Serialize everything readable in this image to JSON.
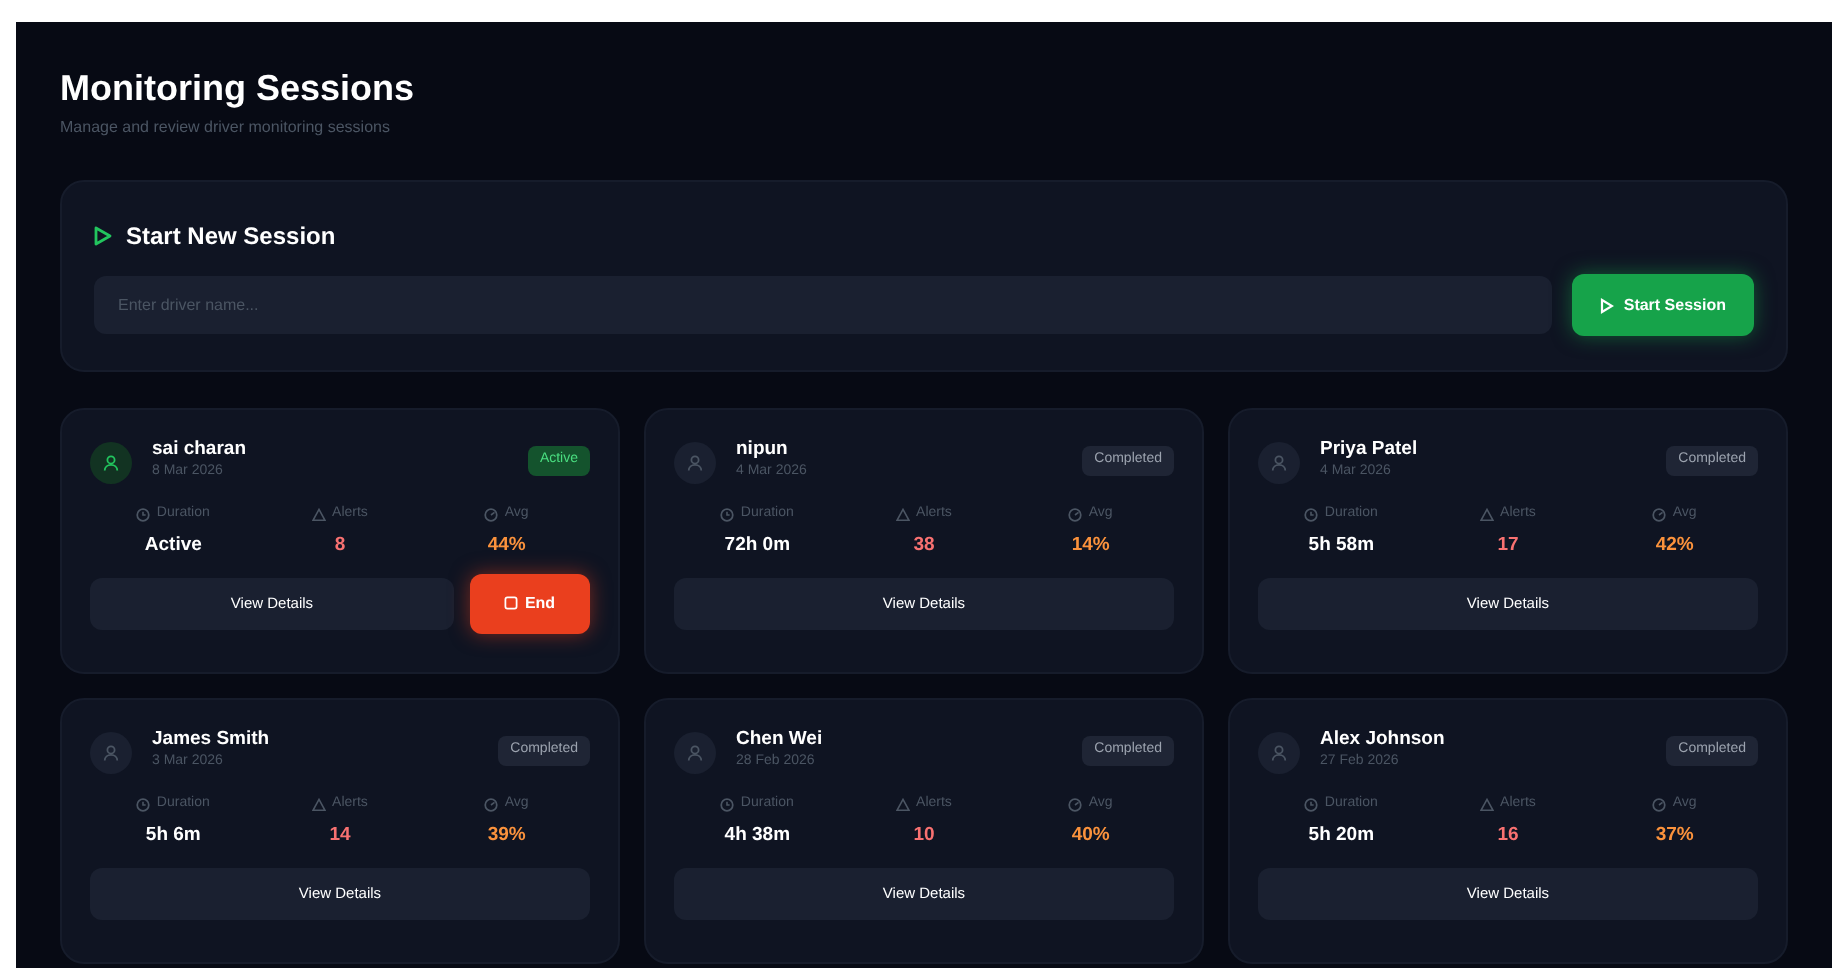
{
  "header": {
    "title": "Monitoring Sessions",
    "subtitle": "Manage and review driver monitoring sessions"
  },
  "new_session": {
    "title": "Start New Session",
    "placeholder": "Enter driver name...",
    "button": "Start Session"
  },
  "sessions": [
    {
      "name": "sai charan",
      "date": "8 Mar 2026",
      "status": "Active",
      "active": true,
      "duration_label": "Duration",
      "duration": "Active",
      "alerts_label": "Alerts",
      "alerts": "8",
      "avg_label": "Avg",
      "avg": "44%",
      "actions": [
        "View Details",
        "End"
      ]
    },
    {
      "name": "nipun",
      "date": "4 Mar 2026",
      "status": "Completed",
      "active": false,
      "duration_label": "Duration",
      "duration": "72h 0m",
      "alerts_label": "Alerts",
      "alerts": "38",
      "avg_label": "Avg",
      "avg": "14%",
      "actions": [
        "View Details"
      ]
    },
    {
      "name": "Priya Patel",
      "date": "4 Mar 2026",
      "status": "Completed",
      "active": false,
      "duration_label": "Duration",
      "duration": "5h 58m",
      "alerts_label": "Alerts",
      "alerts": "17",
      "avg_label": "Avg",
      "avg": "42%",
      "actions": [
        "View Details"
      ]
    },
    {
      "name": "James Smith",
      "date": "3 Mar 2026",
      "status": "Completed",
      "active": false,
      "duration_label": "Duration",
      "duration": "5h 6m",
      "alerts_label": "Alerts",
      "alerts": "14",
      "avg_label": "Avg",
      "avg": "39%",
      "actions": [
        "View Details"
      ]
    },
    {
      "name": "Chen Wei",
      "date": "28 Feb 2026",
      "status": "Completed",
      "active": false,
      "duration_label": "Duration",
      "duration": "4h 38m",
      "alerts_label": "Alerts",
      "alerts": "10",
      "avg_label": "Avg",
      "avg": "40%",
      "actions": [
        "View Details"
      ]
    },
    {
      "name": "Alex Johnson",
      "date": "27 Feb 2026",
      "status": "Completed",
      "active": false,
      "duration_label": "Duration",
      "duration": "5h 20m",
      "alerts_label": "Alerts",
      "alerts": "16",
      "avg_label": "Avg",
      "avg": "37%",
      "actions": [
        "View Details"
      ]
    }
  ]
}
